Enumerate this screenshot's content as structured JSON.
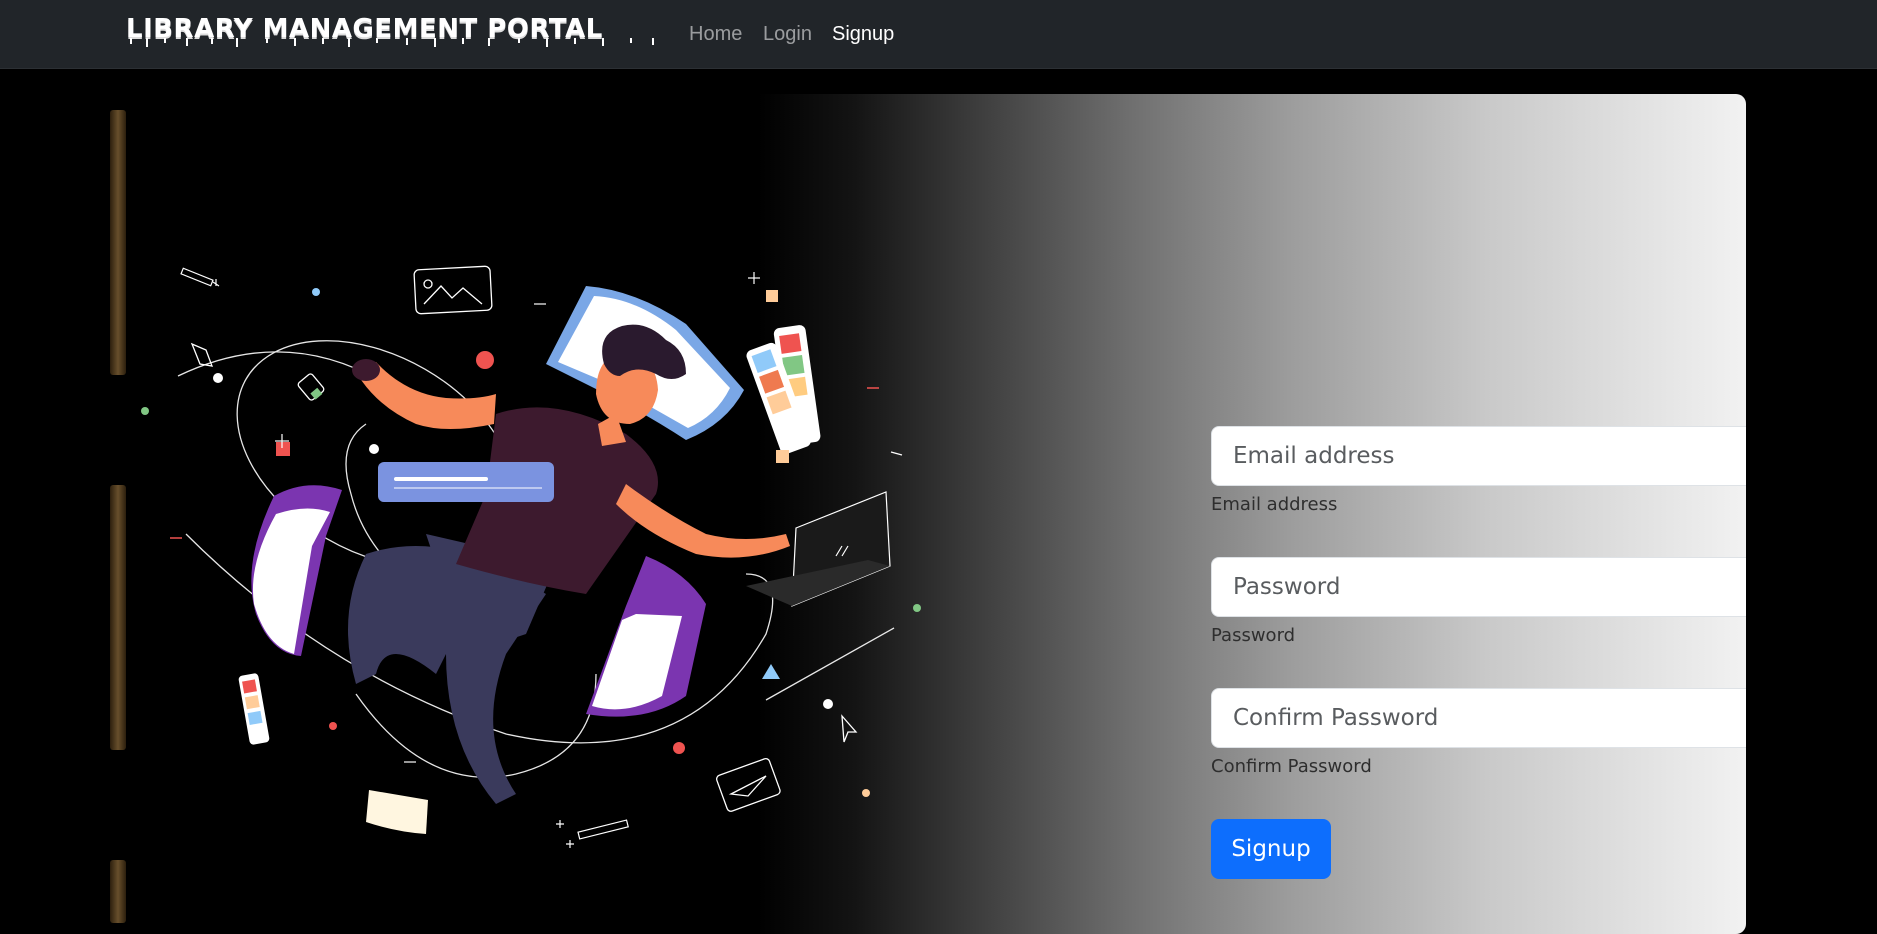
{
  "navbar": {
    "brand": "LIBRARY MANAGEMENT PORTAL",
    "links": [
      {
        "label": "Home"
      },
      {
        "label": "Login"
      },
      {
        "label": "Signup"
      }
    ],
    "active_link": "Signup"
  },
  "form": {
    "email": {
      "placeholder": "Email address",
      "label": "Email address",
      "value": ""
    },
    "password": {
      "placeholder": "Password",
      "label": "Password",
      "value": ""
    },
    "confirm_password": {
      "placeholder": "Confirm Password",
      "label": "Confirm Password",
      "value": ""
    },
    "submit_label": "Signup"
  },
  "colors": {
    "navbar_bg": "#212529",
    "primary_button": "#0d6efd",
    "skin": "#f78a5a",
    "shirt": "#3d1a2e",
    "pants": "#3a3a5c",
    "accent_purple": "#7b35b0",
    "accent_blue": "#7b93e0"
  },
  "icons": [
    "image-icon",
    "pen-nib-icon",
    "laptop-icon",
    "cursor-icon",
    "paper-plane-icon",
    "color-swatch-icon",
    "book-icon"
  ]
}
